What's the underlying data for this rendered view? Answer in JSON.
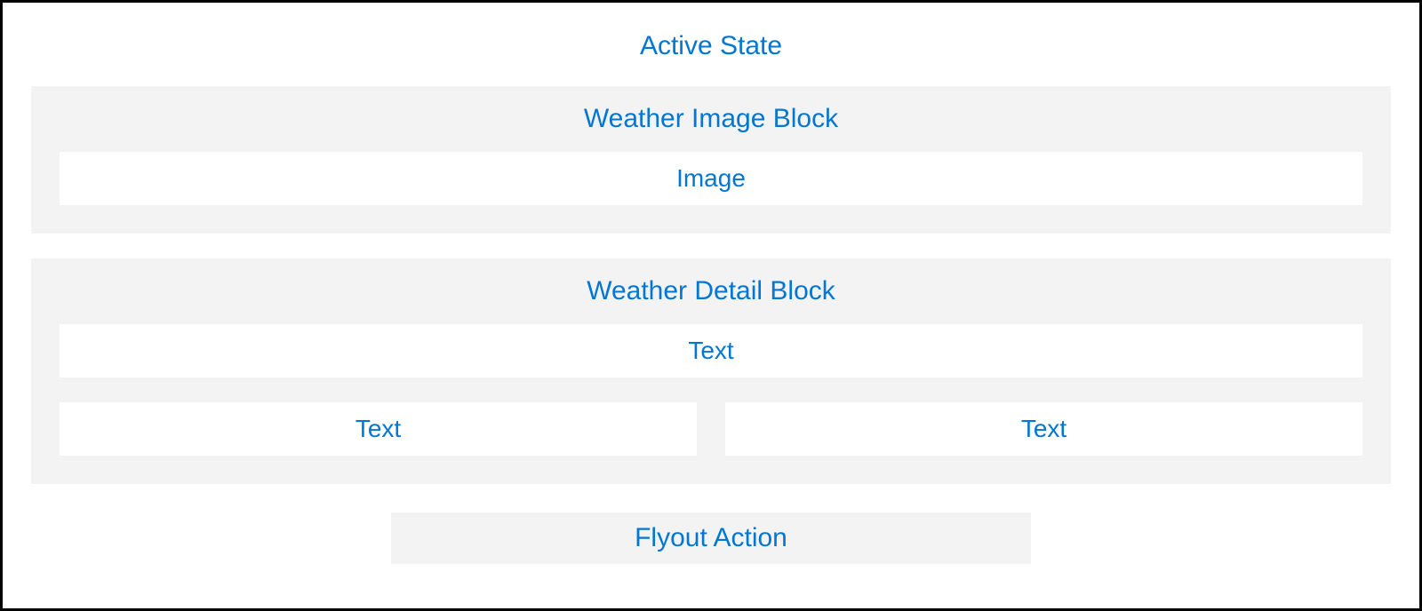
{
  "title": "Active State",
  "imageBlock": {
    "title": "Weather Image Block",
    "slot": "Image"
  },
  "detailBlock": {
    "title": "Weather Detail Block",
    "slot1": "Text",
    "slot2": "Text",
    "slot3": "Text"
  },
  "flyout": "Flyout Action",
  "colors": {
    "accent": "#0176d3",
    "blockBg": "#f3f3f3",
    "slotBg": "#ffffff",
    "border": "#000000"
  }
}
